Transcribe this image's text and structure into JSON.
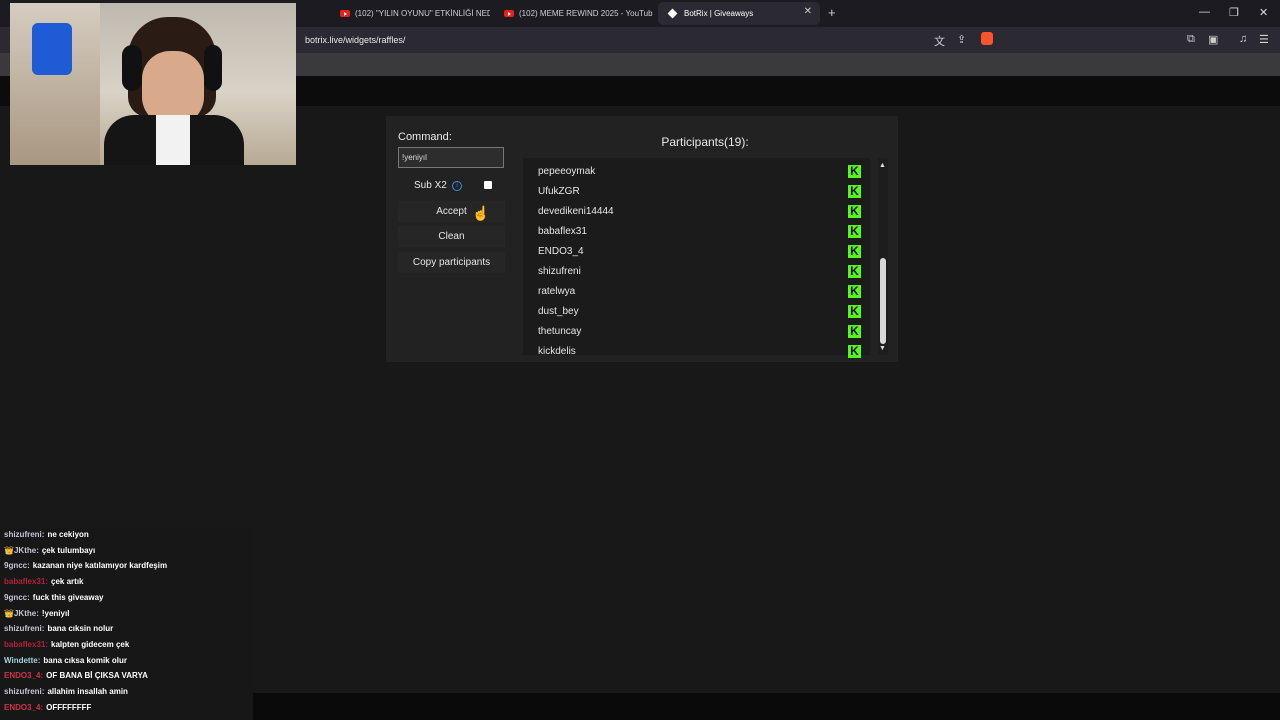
{
  "tabs": [
    {
      "label": "(102) \"YILIN OYUNU\" ETKİNLİĞİ NED",
      "icon": "youtube-icon"
    },
    {
      "label": "(102) MEME REWIND 2025 - YouTub",
      "icon": "youtube-icon"
    },
    {
      "label": "BotRix | Giveaways",
      "icon": "botrix-icon",
      "close": "✕"
    }
  ],
  "new_tab": "+",
  "url": "botrix.live/widgets/raffles/",
  "raffle": {
    "command_label": "Command:",
    "command_value": "!yeniyıl",
    "sub_label": "Sub X2",
    "info_glyph": "i",
    "accept": "Accept",
    "clean": "Clean",
    "copy": "Copy participants",
    "participants_title": "Participants(19):",
    "participants": [
      "pepeeoymak",
      "UfukZGR",
      "devedikeni14444",
      "babaflex31",
      "ENDO3_4",
      "shizufreni",
      "ratelwya",
      "dust_bey",
      "thetuncay",
      "kickdelis"
    ],
    "platform_badge": "K"
  },
  "chat": [
    {
      "user": "shizufreni:",
      "msg": "ne cekiyon",
      "color": "#c4c4d8"
    },
    {
      "user": "👑JKthe:",
      "msg": "çek tulumbayı",
      "color": "#c4c4d8"
    },
    {
      "user": "9gncc:",
      "msg": "kazanan niye katılamıyor kardfeşim",
      "color": "#c4c4d8"
    },
    {
      "user": "babaflex31:",
      "msg": "çek artık",
      "color": "#b3213a"
    },
    {
      "user": "9gncc:",
      "msg": "fuck this giveaway",
      "color": "#c4c4d8"
    },
    {
      "user": "👑JKthe:",
      "msg": "!yeniyıl",
      "color": "#c4c4d8"
    },
    {
      "user": "shizufreni:",
      "msg": "bana cıksin nolur",
      "color": "#c4c4d8"
    },
    {
      "user": "babaflex31:",
      "msg": "kalpten gidecem çek",
      "color": "#b3213a"
    },
    {
      "user": "Windette:",
      "msg": "bana cıksa komik olur",
      "color": "#9fd3df"
    },
    {
      "user": "ENDO3_4:",
      "msg": "OF BANA Bİ ÇIKSA VARYA",
      "color": "#d0304c"
    },
    {
      "user": "shizufreni:",
      "msg": "allahim insallah amin",
      "color": "#c4c4d8"
    },
    {
      "user": "ENDO3_4:",
      "msg": "OFFFFFFFF",
      "color": "#d0304c"
    }
  ]
}
